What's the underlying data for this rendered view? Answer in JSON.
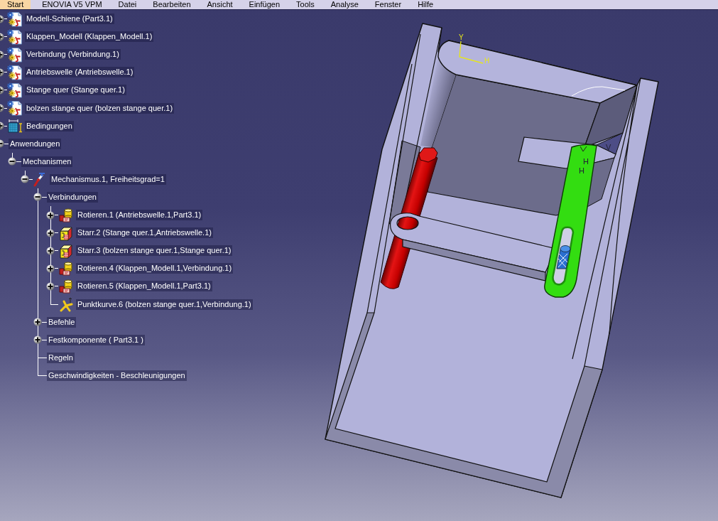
{
  "menu_bar": {
    "items": [
      {
        "label": "Start",
        "selected": true
      },
      {
        "label": "ENOVIA V5 VPM",
        "selected": false
      },
      {
        "label": "Datei",
        "selected": false
      },
      {
        "label": "Bearbeiten",
        "selected": false
      },
      {
        "label": "Ansicht",
        "selected": false
      },
      {
        "label": "Einfügen",
        "selected": false
      },
      {
        "label": "Tools",
        "selected": false
      },
      {
        "label": "Analyse",
        "selected": false
      },
      {
        "label": "Fenster",
        "selected": false
      },
      {
        "label": "Hilfe",
        "selected": false
      }
    ]
  },
  "tree": {
    "nodes": [
      {
        "label": "Modell-Schiene (Part3.1)",
        "kind": "product",
        "expanded": false
      },
      {
        "label": "Klappen_Modell (Klappen_Modell.1)",
        "kind": "product",
        "expanded": false
      },
      {
        "label": "Verbindung (Verbindung.1)",
        "kind": "product",
        "expanded": false
      },
      {
        "label": "Antriebswelle (Antriebswelle.1)",
        "kind": "product",
        "expanded": false
      },
      {
        "label": "Stange quer (Stange quer.1)",
        "kind": "product",
        "expanded": false
      },
      {
        "label": "bolzen stange quer (bolzen stange quer.1)",
        "kind": "product",
        "expanded": false
      },
      {
        "label": "Bedingungen",
        "kind": "constraints",
        "expanded": false
      },
      {
        "label": "Anwendungen",
        "kind": "folder",
        "expanded": true,
        "children": [
          {
            "label": "Mechanismen",
            "kind": "folder",
            "expanded": true,
            "children": [
              {
                "label": "Mechanismus.1, Freiheitsgrad=1",
                "kind": "mechanism",
                "expanded": true,
                "children": [
                  {
                    "label": "Verbindungen",
                    "kind": "folder",
                    "expanded": true,
                    "children": [
                      {
                        "label": "Rotieren.1 (Antriebswelle.1,Part3.1)",
                        "kind": "revolute",
                        "expanded": false
                      },
                      {
                        "label": "Starr.2 (Stange quer.1,Antriebswelle.1)",
                        "kind": "rigid",
                        "expanded": false
                      },
                      {
                        "label": "Starr.3 (bolzen stange quer.1,Stange quer.1)",
                        "kind": "rigid",
                        "expanded": false
                      },
                      {
                        "label": "Rotieren.4 (Klappen_Modell.1,Verbindung.1)",
                        "kind": "revolute",
                        "expanded": false
                      },
                      {
                        "label": "Rotieren.5 (Klappen_Modell.1,Part3.1)",
                        "kind": "revolute",
                        "expanded": false
                      },
                      {
                        "label": "Punktkurve.6 (bolzen stange quer.1,Verbindung.1)",
                        "kind": "point_curve"
                      }
                    ]
                  },
                  {
                    "label": "Befehle",
                    "kind": "folder",
                    "expanded": false
                  },
                  {
                    "label": "Festkomponente ( Part3.1 )",
                    "kind": "folder",
                    "expanded": false
                  },
                  {
                    "label": "Regeln",
                    "kind": "folder"
                  },
                  {
                    "label": "Geschwindigkeiten - Beschleunigungen",
                    "kind": "folder"
                  }
                ]
              }
            ]
          }
        ]
      }
    ]
  },
  "viewer": {
    "axis_labels": [
      "Y",
      "H"
    ],
    "joint_labels": [
      "H",
      "H",
      "V"
    ]
  }
}
